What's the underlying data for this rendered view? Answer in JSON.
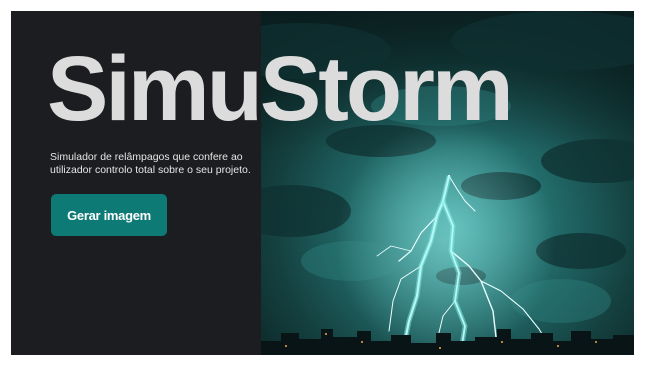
{
  "hero": {
    "title": "SimuStorm",
    "subtitle": "Simulador de relâmpagos que  confere ao utilizador controlo total  sobre o seu projeto.",
    "cta_label": "Gerar imagem"
  },
  "colors": {
    "background": "#1c1d20",
    "accent": "#0e7a76",
    "title": "#dcdcdc",
    "storm_teal": "#1f6b6a"
  },
  "image": {
    "icon": "lightning-storm-photo"
  }
}
